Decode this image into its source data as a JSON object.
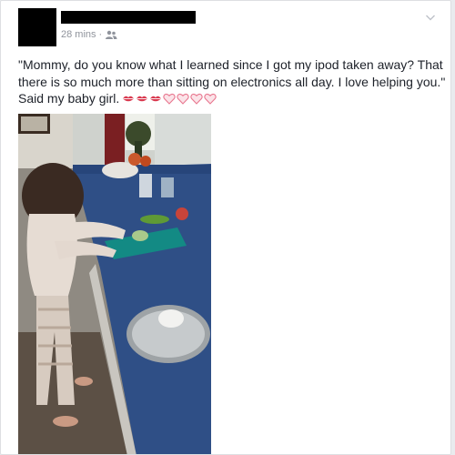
{
  "post": {
    "timestamp": "28 mins",
    "separator": "·",
    "audience_icon": "friends-icon",
    "menu_icon": "chevron-down-icon",
    "text": "\"Mommy, do you know what I learned since I got my ipod taken away? That there is so much more than sitting on electronics all day. I love helping you.\" Said my baby girl.",
    "emoji": [
      "kiss-icon",
      "kiss-icon",
      "kiss-icon",
      "heart-outline-icon",
      "heart-outline-icon",
      "heart-outline-icon",
      "heart-outline-icon"
    ],
    "photo_subject": "child-cutting-vegetables-photo"
  },
  "colors": {
    "meta": "#90949c",
    "text": "#1d2129",
    "heart": "#e8778f",
    "lips": "#d9394f"
  }
}
